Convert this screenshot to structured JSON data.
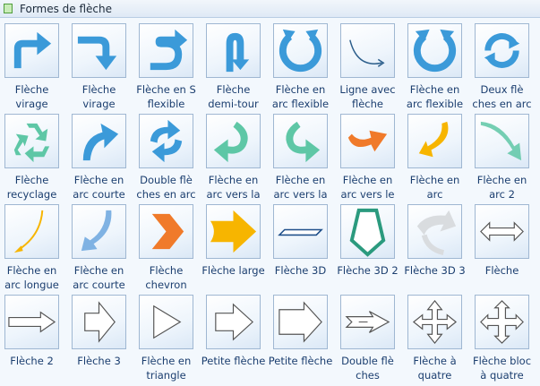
{
  "panel": {
    "title": "Formes de flèche"
  },
  "colors": {
    "blue": "#3b9ad9",
    "teal": "#5ec7a6",
    "orange": "#f07a2a",
    "yellow": "#f7b500",
    "gray": "#d9dcdf",
    "outline": "#555555"
  },
  "items": [
    {
      "label": "Flèche\nvirage",
      "icon": "bent-arrow-up-right-icon"
    },
    {
      "label": "Flèche\nvirage",
      "icon": "bent-arrow-down-right-icon"
    },
    {
      "label": "Flèche en S\nflexible",
      "icon": "s-arrow-icon"
    },
    {
      "label": "Flèche\ndemi-tour",
      "icon": "u-turn-arrow-icon"
    },
    {
      "label": "Flèche en\narc flexible",
      "icon": "circular-arc-arrow-icon"
    },
    {
      "label": "Ligne avec\nflèche",
      "icon": "curved-line-arrow-icon"
    },
    {
      "label": "Flèche en\narc flexible",
      "icon": "circular-arc-arrow-2-icon"
    },
    {
      "label": "Deux flè\nches en arc",
      "icon": "two-circular-arrows-icon"
    },
    {
      "label": "Flèche\nrecyclage",
      "icon": "recycle-icon"
    },
    {
      "label": "Flèche en\narc courte",
      "icon": "short-arc-arrow-icon"
    },
    {
      "label": "Double flè\nches en arc",
      "icon": "double-arc-arrows-icon"
    },
    {
      "label": "Flèche en\narc vers la",
      "icon": "teal-arc-arrow-left-icon"
    },
    {
      "label": "Flèche en\narc vers la",
      "icon": "teal-arc-arrow-right-icon"
    },
    {
      "label": "Flèche en\narc vers le",
      "icon": "orange-arc-arrow-up-icon"
    },
    {
      "label": "Flèche en\narc",
      "icon": "yellow-arc-arrow-icon"
    },
    {
      "label": "Flèche en\narc 2",
      "icon": "teal-arc-arrow-2-icon"
    },
    {
      "label": "Flèche en\narc longue",
      "icon": "yellow-long-arc-arrow-icon"
    },
    {
      "label": "Flèche en\narc courte",
      "icon": "blue-short-arc-arrow-icon"
    },
    {
      "label": "Flèche\nchevron",
      "icon": "chevron-icon"
    },
    {
      "label": "Flèche large",
      "icon": "large-arrow-icon"
    },
    {
      "label": "Flèche 3D",
      "icon": "arrow-3d-icon"
    },
    {
      "label": "Flèche 3D 2",
      "icon": "arrow-3d-2-icon"
    },
    {
      "label": "Flèche 3D 3",
      "icon": "arrow-3d-3-icon"
    },
    {
      "label": "Flèche",
      "icon": "double-headed-arrow-icon"
    },
    {
      "label": "Flèche 2",
      "icon": "arrow-2-icon"
    },
    {
      "label": "Flèche 3",
      "icon": "arrow-3-icon"
    },
    {
      "label": "Flèche en\ntriangle",
      "icon": "triangle-arrow-icon"
    },
    {
      "label": "Petite flèche",
      "icon": "small-arrow-icon"
    },
    {
      "label": "Petite flèche",
      "icon": "small-arrow-2-icon"
    },
    {
      "label": "Double flè\nches",
      "icon": "double-arrows-icon"
    },
    {
      "label": "Flèche à\nquatre",
      "icon": "four-way-arrow-icon"
    },
    {
      "label": "Flèche bloc\nà quatre",
      "icon": "four-way-block-arrow-icon"
    }
  ]
}
